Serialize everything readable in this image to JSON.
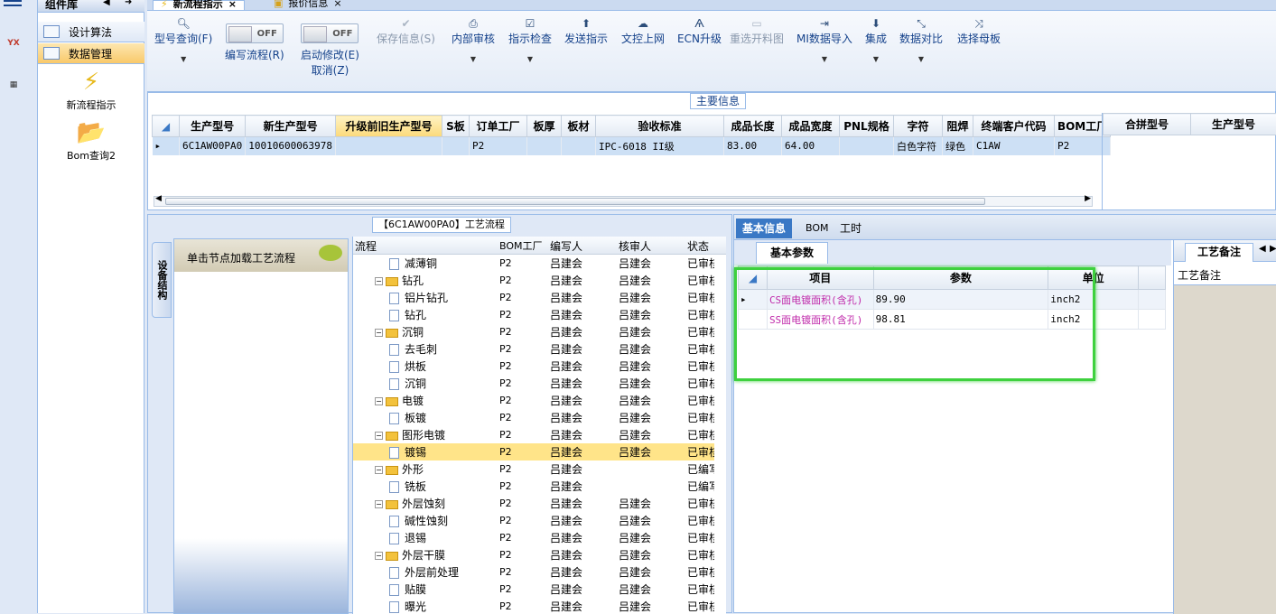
{
  "leftstrip": {
    "menu_icon": "hamburger-icon",
    "app1": "YX",
    "app2": "calc"
  },
  "component": {
    "title": "组件库",
    "nav": [
      {
        "label": "设计算法"
      },
      {
        "label": "数据管理",
        "active": true
      }
    ],
    "big_icons": [
      {
        "label": "新流程指示",
        "icon": "lightning-icon"
      },
      {
        "label": "Bom查询2",
        "icon": "folder-icon"
      }
    ]
  },
  "top_tabs": [
    {
      "label": "新流程指示"
    },
    {
      "label": "报价信息"
    }
  ],
  "toolbar": {
    "model_query": "型号查询(F)",
    "write_flow": "编写流程(R)",
    "toggle_off1": "OFF",
    "start_modify": "启动修改(E)",
    "cancel": "取消(Z)",
    "toggle_off2": "OFF",
    "save": "保存信息(S)",
    "internal_review": "内部审核",
    "indicator_check": "指示检查",
    "send_indicator": "发送指示",
    "doc_upload": "文控上网",
    "ecn_upgrade": "ECN升级",
    "reselect": "重选开料图",
    "mi_import": "MI数据导入",
    "integrate": "集成",
    "data_compare": "数据对比",
    "select_master": "选择母板"
  },
  "main_info": {
    "title": "主要信息",
    "columns": [
      "生产型号",
      "新生产型号",
      "升级前旧生产型号",
      "S板",
      "订单工厂",
      "板厚",
      "板材",
      "验收标准",
      "成品长度",
      "成品宽度",
      "PNL规格",
      "字符",
      "阻焊",
      "终端客户代码",
      "BOM工厂"
    ],
    "row": [
      "6C1AW00PA0",
      "10010600063978",
      "",
      "",
      "P2",
      "",
      "",
      "IPC-6018 II级",
      "83.00",
      "64.00",
      "",
      "白色字符",
      "绿色",
      "C1AW",
      "P2"
    ],
    "merge_columns": [
      "合拼型号",
      "生产型号"
    ]
  },
  "process": {
    "title": "【6C1AW00PA0】工艺流程",
    "side_tab": "设备结构",
    "click_hint": "单击节点加载工艺流程",
    "columns": [
      "流程",
      "BOM工厂",
      "编写人",
      "核审人",
      "状态"
    ],
    "rows": [
      {
        "name": "减薄铜",
        "level": 2,
        "type": "doc",
        "bom": "P2",
        "writer": "吕建会",
        "reviewer": "吕建会",
        "status": "已审核"
      },
      {
        "name": "钻孔",
        "level": 1,
        "type": "folder",
        "bom": "P2",
        "writer": "吕建会",
        "reviewer": "吕建会",
        "status": "已审核"
      },
      {
        "name": "铝片钻孔",
        "level": 2,
        "type": "doc",
        "bom": "P2",
        "writer": "吕建会",
        "reviewer": "吕建会",
        "status": "已审核"
      },
      {
        "name": "钻孔",
        "level": 2,
        "type": "doc",
        "bom": "P2",
        "writer": "吕建会",
        "reviewer": "吕建会",
        "status": "已审核"
      },
      {
        "name": "沉铜",
        "level": 1,
        "type": "folder",
        "bom": "P2",
        "writer": "吕建会",
        "reviewer": "吕建会",
        "status": "已审核"
      },
      {
        "name": "去毛刺",
        "level": 2,
        "type": "doc",
        "bom": "P2",
        "writer": "吕建会",
        "reviewer": "吕建会",
        "status": "已审核"
      },
      {
        "name": "烘板",
        "level": 2,
        "type": "doc",
        "bom": "P2",
        "writer": "吕建会",
        "reviewer": "吕建会",
        "status": "已审核"
      },
      {
        "name": "沉铜",
        "level": 2,
        "type": "doc",
        "bom": "P2",
        "writer": "吕建会",
        "reviewer": "吕建会",
        "status": "已审核"
      },
      {
        "name": "电镀",
        "level": 1,
        "type": "folder",
        "bom": "P2",
        "writer": "吕建会",
        "reviewer": "吕建会",
        "status": "已审核"
      },
      {
        "name": "板镀",
        "level": 2,
        "type": "doc",
        "bom": "P2",
        "writer": "吕建会",
        "reviewer": "吕建会",
        "status": "已审核"
      },
      {
        "name": "图形电镀",
        "level": 1,
        "type": "folder",
        "bom": "P2",
        "writer": "吕建会",
        "reviewer": "吕建会",
        "status": "已审核"
      },
      {
        "name": "镀锡",
        "level": 2,
        "type": "doc",
        "bom": "P2",
        "writer": "吕建会",
        "reviewer": "吕建会",
        "status": "已审核",
        "highlight": true
      },
      {
        "name": "外形",
        "level": 1,
        "type": "folder",
        "bom": "P2",
        "writer": "吕建会",
        "reviewer": "",
        "status": "已编写"
      },
      {
        "name": "铣板",
        "level": 2,
        "type": "doc",
        "bom": "P2",
        "writer": "吕建会",
        "reviewer": "",
        "status": "已编写"
      },
      {
        "name": "外层蚀刻",
        "level": 1,
        "type": "folder",
        "bom": "P2",
        "writer": "吕建会",
        "reviewer": "吕建会",
        "status": "已审核"
      },
      {
        "name": "碱性蚀刻",
        "level": 2,
        "type": "doc",
        "bom": "P2",
        "writer": "吕建会",
        "reviewer": "吕建会",
        "status": "已审核"
      },
      {
        "name": "退锡",
        "level": 2,
        "type": "doc",
        "bom": "P2",
        "writer": "吕建会",
        "reviewer": "吕建会",
        "status": "已审核"
      },
      {
        "name": "外层干膜",
        "level": 1,
        "type": "folder",
        "bom": "P2",
        "writer": "吕建会",
        "reviewer": "吕建会",
        "status": "已审核"
      },
      {
        "name": "外层前处理",
        "level": 2,
        "type": "doc",
        "bom": "P2",
        "writer": "吕建会",
        "reviewer": "吕建会",
        "status": "已审核"
      },
      {
        "name": "贴膜",
        "level": 2,
        "type": "doc",
        "bom": "P2",
        "writer": "吕建会",
        "reviewer": "吕建会",
        "status": "已审核"
      },
      {
        "name": "曝光",
        "level": 2,
        "type": "doc",
        "bom": "P2",
        "writer": "吕建会",
        "reviewer": "吕建会",
        "status": "已审核"
      }
    ]
  },
  "right": {
    "tabs": [
      "基本信息",
      "BOM",
      "工时"
    ],
    "subtab": "基本参数",
    "columns": [
      "项目",
      "参数",
      "单位"
    ],
    "rows": [
      {
        "item": "CS面电镀面积(含孔)",
        "value": "89.90",
        "unit": "inch2"
      },
      {
        "item": "SS面电镀面积(含孔)",
        "value": "98.81",
        "unit": "inch2"
      }
    ],
    "notes_tab": "工艺备注",
    "notes_col": "工艺备注"
  }
}
